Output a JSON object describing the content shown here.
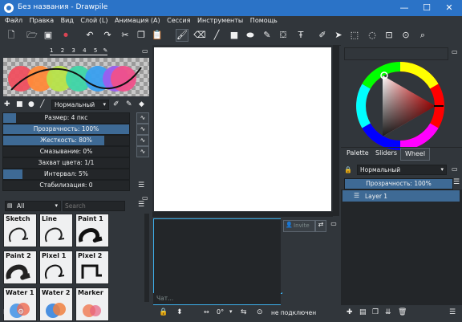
{
  "window": {
    "title": "Без названия - Drawpile",
    "min_glyph": "—",
    "max_glyph": "☐",
    "close_glyph": "✕"
  },
  "menu": [
    "Файл",
    "Правка",
    "Вид",
    "Слой (L)",
    "Анимация (A)",
    "Сессия",
    "Инструменты",
    "Помощь"
  ],
  "palette_tabs": [
    "1",
    "2",
    "3",
    "4",
    "5"
  ],
  "brush_settings": {
    "blend_mode": "Нормальный",
    "sliders": [
      {
        "label": "Размер: 4 пкс",
        "value": 0.1
      },
      {
        "label": "Прозрачность: 100%",
        "value": 1.0
      },
      {
        "label": "Жесткость: 80%",
        "value": 0.8
      },
      {
        "label": "Смазывание: 0%",
        "value": 0.0
      },
      {
        "label": "Захват цвета: 1/1",
        "value": 0.0
      },
      {
        "label": "Интервал: 5%",
        "value": 0.15
      },
      {
        "label": "Стабилизация: 0",
        "value": 0.0
      }
    ]
  },
  "brush_library": {
    "category": "All",
    "search_placeholder": "Search",
    "brushes": [
      "Sketch",
      "Line",
      "Paint 1",
      "Paint 2",
      "Pixel 1",
      "Pixel 2",
      "Water 1",
      "Water 2",
      "Marker"
    ]
  },
  "chat": {
    "input_placeholder": "Чат...",
    "invite_label": "Invite"
  },
  "status": {
    "rotation": "0°",
    "connection": "не подключен"
  },
  "color_panel": {
    "tabs": [
      "Palette",
      "Sliders",
      "Wheel"
    ],
    "active_tab": "Wheel",
    "accent": "#ff0000"
  },
  "layers": {
    "blend_mode": "Нормальный",
    "opacity_label": "Прозрачность: 100%",
    "items": [
      "Layer 1"
    ]
  }
}
